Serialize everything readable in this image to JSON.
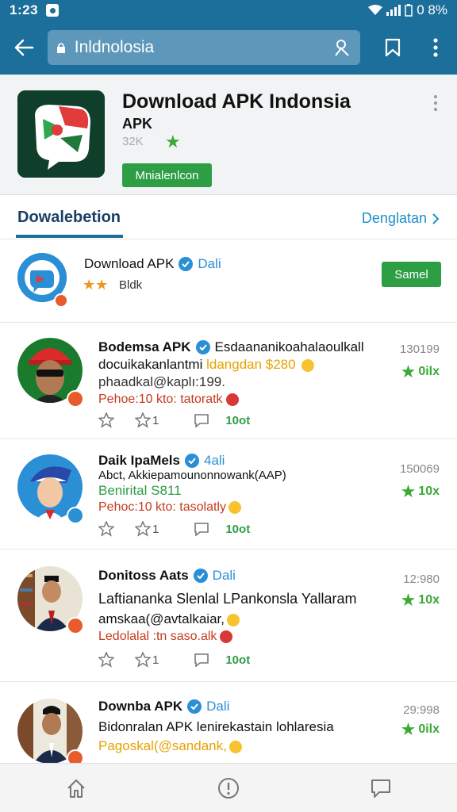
{
  "status_bar": {
    "time": "1:23",
    "battery": "0 8%"
  },
  "app_bar": {
    "search_text": "Inldnolosia"
  },
  "app_header": {
    "title": "Download APK Indonsia",
    "subtitle": "APK",
    "size": "32K",
    "install_label": "Mnialenlcon"
  },
  "tabs": {
    "active": "Dowalebetion",
    "right": "Denglatan"
  },
  "developer": {
    "name": "Download APK",
    "source": "Dali",
    "rating_text": "Bldk",
    "button_label": "Samel"
  },
  "posts": [
    {
      "author": "Bodemsa APK",
      "extra": "Esdaananikoahalaoulkall",
      "line1": "docuikakanlantmi",
      "line1_highlight": "ldangdan $280",
      "line2": "phaadkal@kaplı:199.",
      "link": "Pehoe:10 kto: tatoratk",
      "likes": "1",
      "share": "10ot",
      "count": "130199",
      "score": "0ilx"
    },
    {
      "author": "Daik IpaMels",
      "source": "4ali",
      "line1": "Abct, Akkiepamounonnowank(AAP)",
      "line2": "Benirital S811",
      "link": "Pehoc:10 kto: tasolatly",
      "likes": "1",
      "share": "10ot",
      "count": "150069",
      "score": "10x"
    },
    {
      "author": "Donitoss Aats",
      "source": "Dali",
      "line1": "Laftiananka Slenlal LPankonsla Yallaram",
      "line2": "amskaa(@avtalkaiar,",
      "link": "Ledolalal :tn saso.alk",
      "likes": "1",
      "share": "10ot",
      "count": "12:980",
      "score": "10x"
    },
    {
      "author": "Downba APK",
      "source": "Dali",
      "line1": "Bidonralan APK lenirekastain lohlaresia",
      "line2": "Pagoskal(@sandank,",
      "count": "29:998",
      "score": "0ilx"
    }
  ],
  "colors": {
    "primary": "#1d6f9b",
    "accent_green": "#2e9e45",
    "link_blue": "#2a8fd4",
    "warning_red": "#c53a1c"
  },
  "icons": {
    "back": "arrow-left-icon",
    "bookmark": "bookmark-icon",
    "more": "more-vert-icon",
    "home": "home-icon",
    "info": "info-icon",
    "chat": "chat-icon"
  }
}
